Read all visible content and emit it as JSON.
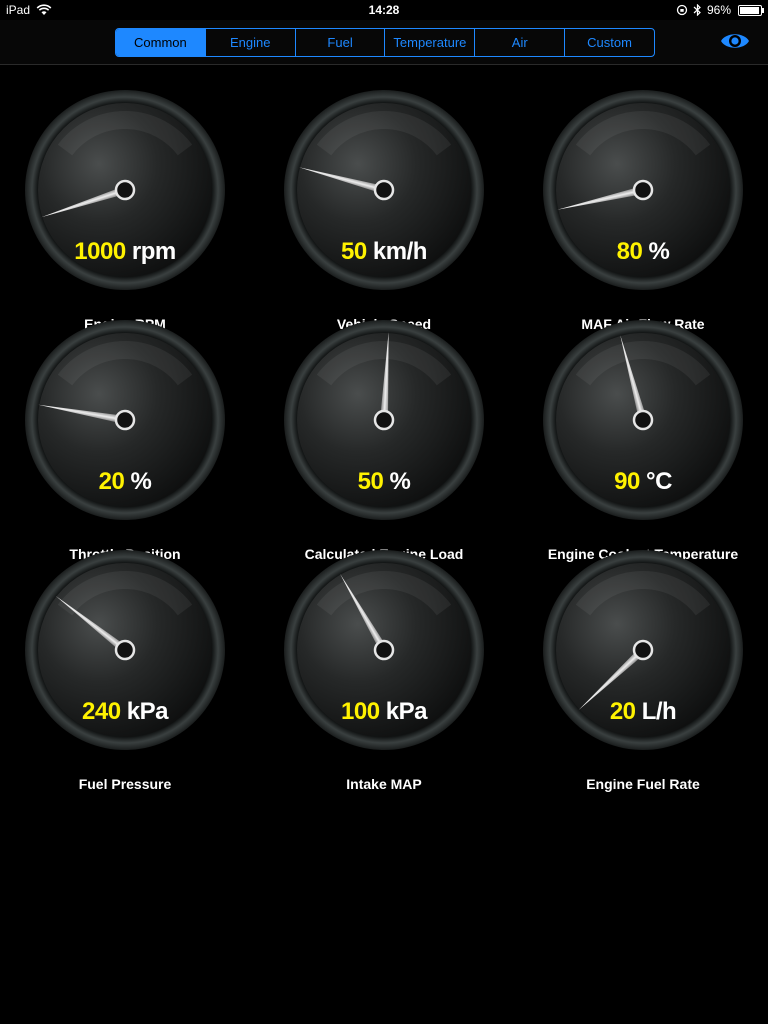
{
  "status": {
    "device": "iPad",
    "time": "14:28",
    "battery": "96%",
    "battery_level": 0.96
  },
  "tabs": [
    "Common",
    "Engine",
    "Fuel",
    "Temperature",
    "Air",
    "Custom"
  ],
  "active_tab": 0,
  "colors": {
    "accent": "#1e88ff",
    "value": "#fff200",
    "background": "#000000"
  },
  "icons": {
    "eye": "eye-icon",
    "wifi": "wifi-icon",
    "bluetooth": "bluetooth-icon",
    "lock": "rotation-lock-icon"
  },
  "gauges": [
    {
      "name": "engine-rpm",
      "value": "1000",
      "unit": "rpm",
      "label": "Engine RPM",
      "needle_angle": -108
    },
    {
      "name": "vehicle-speed",
      "value": "50",
      "unit": "km/h",
      "label": "Vehicle Speed",
      "needle_angle": -75
    },
    {
      "name": "maf-air-flow-rate",
      "value": "80",
      "unit": "%",
      "label": "MAF Air Flow Rate",
      "needle_angle": -103
    },
    {
      "name": "throttle-position",
      "value": "20",
      "unit": "%",
      "label": "Throttle Position",
      "needle_angle": -80
    },
    {
      "name": "calculated-engine-load",
      "value": "50",
      "unit": "%",
      "label": "Calculated Engine Load",
      "needle_angle": 3
    },
    {
      "name": "engine-coolant-temperature",
      "value": "90",
      "unit": "°C",
      "label": "Engine Coolant Temperature",
      "needle_angle": -15
    },
    {
      "name": "fuel-pressure",
      "value": "240",
      "unit": "kPa",
      "label": "Fuel Pressure",
      "needle_angle": -52
    },
    {
      "name": "intake-map",
      "value": "100",
      "unit": "kPa",
      "label": "Intake MAP",
      "needle_angle": -30
    },
    {
      "name": "engine-fuel-rate",
      "value": "20",
      "unit": "L/h",
      "label": "Engine Fuel Rate",
      "needle_angle": -133
    }
  ]
}
